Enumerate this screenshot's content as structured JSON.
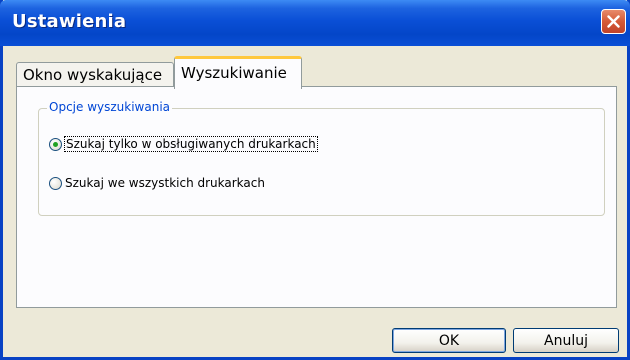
{
  "window": {
    "title": "Ustawienia"
  },
  "tabs": [
    {
      "label": "Okno wyskakujące",
      "active": false
    },
    {
      "label": "Wyszukiwanie",
      "active": true
    }
  ],
  "group": {
    "legend": "Opcje wyszukiwania",
    "options": [
      {
        "label": "Szukaj tylko w obsługiwanych drukarkach",
        "checked": true
      },
      {
        "label": "Szukaj we wszystkich drukarkach",
        "checked": false
      }
    ]
  },
  "buttons": {
    "ok": "OK",
    "cancel": "Anuluj"
  },
  "colors": {
    "titlebar": "#0a4fd6",
    "close": "#d55a37",
    "legend": "#0046d5",
    "radio_dot": "#21a121"
  }
}
